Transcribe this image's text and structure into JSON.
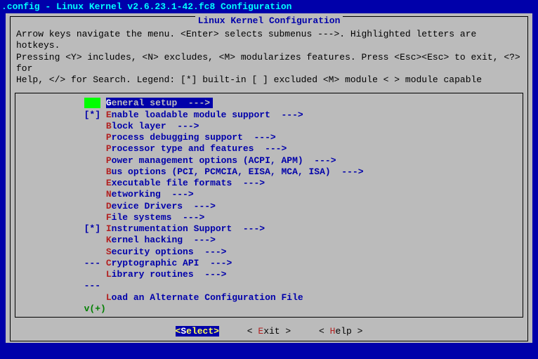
{
  "title": ".config - Linux Kernel v2.6.23.1-42.fc8 Configuration",
  "box_title": "Linux Kernel Configuration",
  "help": {
    "line1": "Arrow keys navigate the menu.  <Enter> selects submenus --->.  Highlighted letters are hotkeys.",
    "line2": "Pressing <Y> includes, <N> excludes, <M> modularizes features.  Press <Esc><Esc> to exit, <?> for",
    "line3": "Help, </> for Search.  Legend: [*] built-in  [ ] excluded  <M> module  < > module capable"
  },
  "items": [
    {
      "prefix": "   ",
      "hot": "G",
      "rest": "eneral setup  --->",
      "selected": true
    },
    {
      "prefix": "[*]",
      "hot": "E",
      "rest": "nable loadable module support  --->"
    },
    {
      "prefix": "   ",
      "hot": "B",
      "rest": "lock layer  --->"
    },
    {
      "prefix": "   ",
      "hot": "P",
      "rest": "rocess debugging support  --->"
    },
    {
      "prefix": "   ",
      "hot": "P",
      "rest": "rocessor type and features  --->"
    },
    {
      "prefix": "   ",
      "hot": "P",
      "rest": "ower management options (ACPI, APM)  --->"
    },
    {
      "prefix": "   ",
      "hot": "B",
      "rest": "us options (PCI, PCMCIA, EISA, MCA, ISA)  --->"
    },
    {
      "prefix": "   ",
      "hot": "E",
      "rest": "xecutable file formats  --->"
    },
    {
      "prefix": "   ",
      "hot": "N",
      "rest": "etworking  --->"
    },
    {
      "prefix": "   ",
      "hot": "D",
      "rest": "evice Drivers  --->"
    },
    {
      "prefix": "   ",
      "hot": "F",
      "rest": "ile systems  --->"
    },
    {
      "prefix": "[*]",
      "hot": "I",
      "rest": "nstrumentation Support  --->"
    },
    {
      "prefix": "   ",
      "hot": "K",
      "rest": "ernel hacking  --->"
    },
    {
      "prefix": "   ",
      "hot": "S",
      "rest": "ecurity options  --->"
    },
    {
      "prefix": "---",
      "hot": "C",
      "rest": "ryptographic API  --->"
    },
    {
      "prefix": "   ",
      "hot": "L",
      "rest": "ibrary routines  --->"
    },
    {
      "prefix": "---",
      "hot": "",
      "rest": ""
    },
    {
      "prefix": "   ",
      "hot": "L",
      "rest": "oad an Alternate Configuration File"
    }
  ],
  "more": "v(+)",
  "buttons": {
    "select": {
      "before": "<",
      "hot": "S",
      "after": "elect>",
      "selected": true
    },
    "exit": {
      "before": "< ",
      "hot": "E",
      "after": "xit >",
      "selected": false
    },
    "help": {
      "before": "< ",
      "hot": "H",
      "after": "elp >",
      "selected": false
    }
  }
}
